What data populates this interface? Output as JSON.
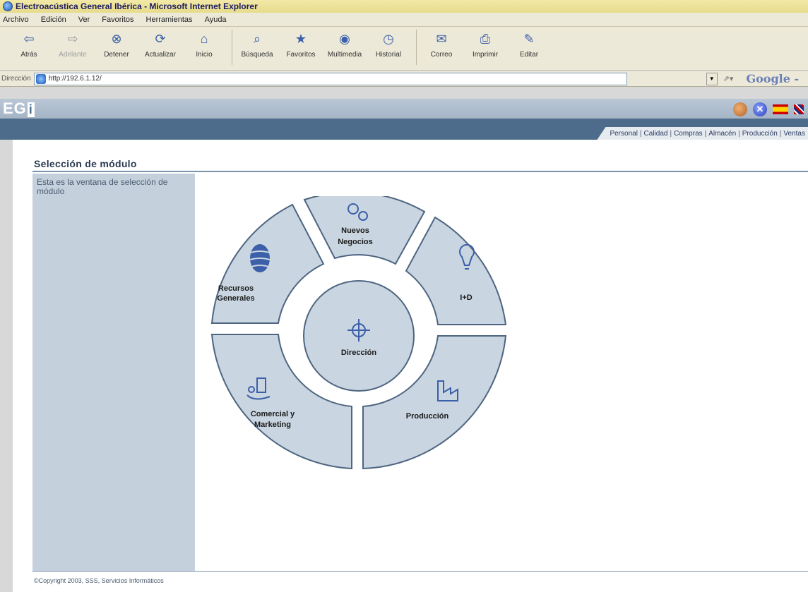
{
  "window": {
    "title": "Electroacústica General Ibérica - Microsoft Internet Explorer"
  },
  "menu": [
    "Archivo",
    "Edición",
    "Ver",
    "Favoritos",
    "Herramientas",
    "Ayuda"
  ],
  "toolbar": {
    "back": "Atrás",
    "forward": "Adelante",
    "stop": "Detener",
    "refresh": "Actualizar",
    "home": "Inicio",
    "search": "Búsqueda",
    "favorites": "Favoritos",
    "media": "Multimedia",
    "history": "Historial",
    "mail": "Correo",
    "print": "Imprimir",
    "edit": "Editar"
  },
  "address": {
    "label": "Dirección",
    "url": "http://192.6.1.12/",
    "google": "Google -"
  },
  "app": {
    "logo": "EG",
    "logo_i": "i",
    "nav_links": [
      "Personal",
      "Calidad",
      "Compras",
      "Almacén",
      "Producción",
      "Ventas"
    ]
  },
  "page": {
    "title": "Selección de módulo",
    "description": "Esta es la ventana de selección de módulo",
    "footer": "©Copyright 2003, SSS, Servicios Informáticos"
  },
  "modules": {
    "center": "Dirección",
    "nuevos_1": "Nuevos",
    "nuevos_2": "Negocios",
    "id": "I+D",
    "produccion": "Producción",
    "comercial_1": "Comercial y",
    "comercial_2": "Marketing",
    "recursos_1": "Recursos",
    "recursos_2": "Generales"
  },
  "colors": {
    "segment": "#c9d5e0",
    "ring_stroke": "#4d6580",
    "header_dark": "#4d6c8c"
  }
}
